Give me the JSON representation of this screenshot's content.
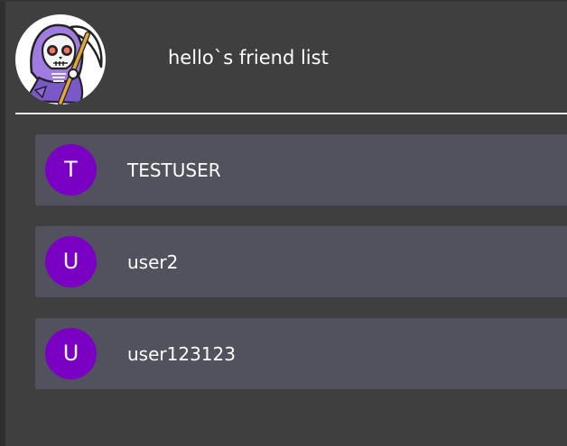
{
  "header": {
    "title": "hello`s friend list",
    "avatar_icon": "grim-reaper-icon"
  },
  "friends": [
    {
      "initial": "T",
      "name": "TESTUSER"
    },
    {
      "initial": "U",
      "name": "user2"
    },
    {
      "initial": "U",
      "name": "user123123"
    }
  ],
  "colors": {
    "background": "#3f3f3f",
    "row_background": "#52525f",
    "avatar_background": "#7a00c4",
    "text": "#ffffff",
    "divider": "#e8e8e8"
  }
}
